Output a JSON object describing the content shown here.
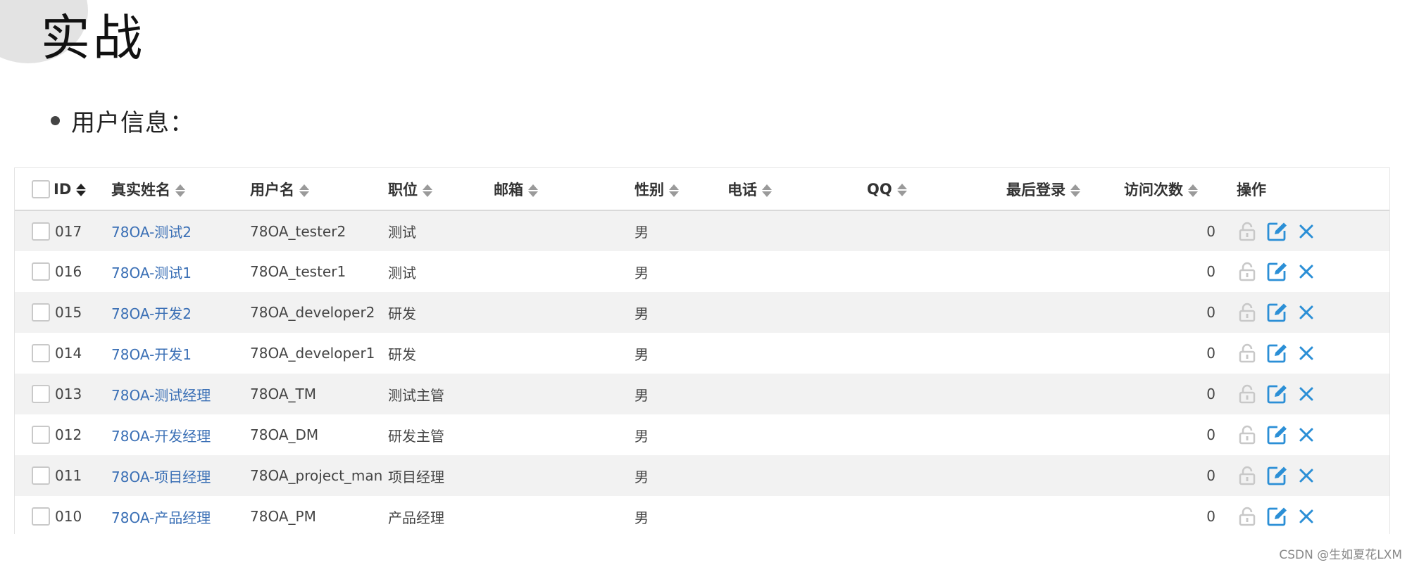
{
  "slide": {
    "title": "实战",
    "bullet": "用户信息："
  },
  "table": {
    "columns": [
      "ID",
      "真实姓名",
      "用户名",
      "职位",
      "邮箱",
      "性别",
      "电话",
      "QQ",
      "最后登录",
      "访问次数",
      "操作"
    ],
    "rows": [
      {
        "id": "017",
        "name": "78OA-测试2",
        "username": "78OA_tester2",
        "position": "测试",
        "email": "",
        "gender": "男",
        "phone": "",
        "qq": "",
        "last_login": "",
        "visits": "0"
      },
      {
        "id": "016",
        "name": "78OA-测试1",
        "username": "78OA_tester1",
        "position": "测试",
        "email": "",
        "gender": "男",
        "phone": "",
        "qq": "",
        "last_login": "",
        "visits": "0"
      },
      {
        "id": "015",
        "name": "78OA-开发2",
        "username": "78OA_developer2",
        "position": "研发",
        "email": "",
        "gender": "男",
        "phone": "",
        "qq": "",
        "last_login": "",
        "visits": "0"
      },
      {
        "id": "014",
        "name": "78OA-开发1",
        "username": "78OA_developer1",
        "position": "研发",
        "email": "",
        "gender": "男",
        "phone": "",
        "qq": "",
        "last_login": "",
        "visits": "0"
      },
      {
        "id": "013",
        "name": "78OA-测试经理",
        "username": "78OA_TM",
        "position": "测试主管",
        "email": "",
        "gender": "男",
        "phone": "",
        "qq": "",
        "last_login": "",
        "visits": "0"
      },
      {
        "id": "012",
        "name": "78OA-开发经理",
        "username": "78OA_DM",
        "position": "研发主管",
        "email": "",
        "gender": "男",
        "phone": "",
        "qq": "",
        "last_login": "",
        "visits": "0"
      },
      {
        "id": "011",
        "name": "78OA-项目经理",
        "username": "78OA_project_man",
        "position": "项目经理",
        "email": "",
        "gender": "男",
        "phone": "",
        "qq": "",
        "last_login": "",
        "visits": "0"
      },
      {
        "id": "010",
        "name": "78OA-产品经理",
        "username": "78OA_PM",
        "position": "产品经理",
        "email": "",
        "gender": "男",
        "phone": "",
        "qq": "",
        "last_login": "",
        "visits": "0"
      }
    ],
    "row_actions": [
      "lock-icon",
      "edit-icon",
      "delete-icon"
    ]
  },
  "colors": {
    "link": "#3a6fb5",
    "edit": "#2b8fd6",
    "delete": "#2b8fd6",
    "lock": "#c8c8c8",
    "row_stripe": "#f2f2f2"
  },
  "watermark": "CSDN @生如夏花LXM"
}
